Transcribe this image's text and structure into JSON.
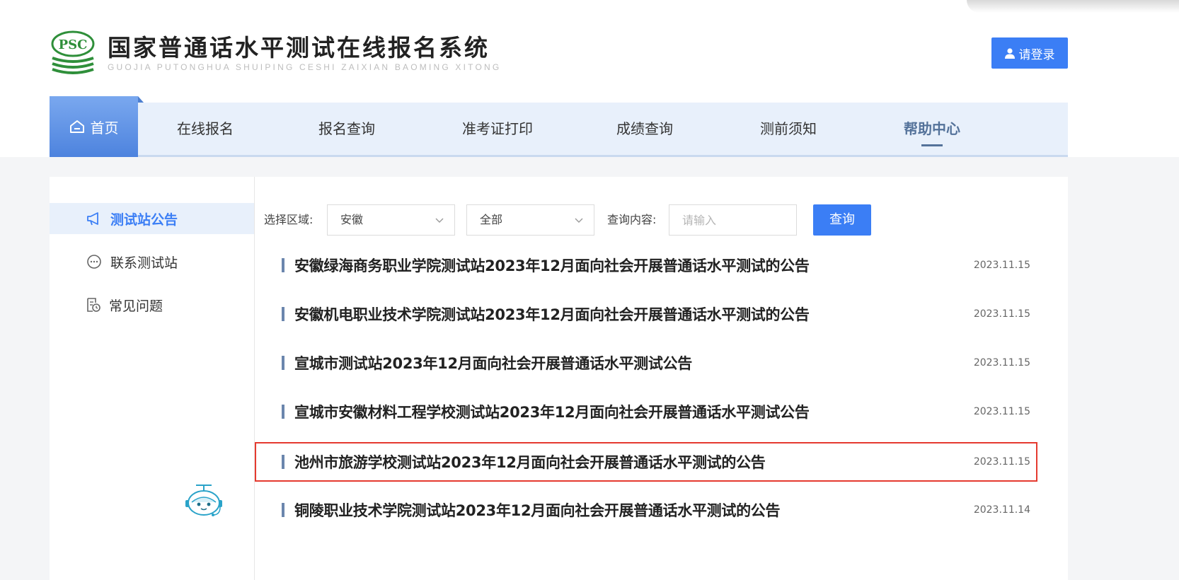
{
  "header": {
    "logo_badge": "PSC",
    "title": "国家普通话水平测试在线报名系统",
    "subtitle": "GUOJIA PUTONGHUA SHUIPING CESHI ZAIXIAN BAOMING XITONG",
    "login_label": "请登录"
  },
  "nav": {
    "home": "首页",
    "items": [
      "在线报名",
      "报名查询",
      "准考证打印",
      "成绩查询",
      "测前须知",
      "帮助中心"
    ],
    "active": "帮助中心"
  },
  "sidebar": {
    "items": [
      {
        "label": "测试站公告",
        "icon": "megaphone-icon",
        "active": true
      },
      {
        "label": "联系测试站",
        "icon": "chat-bubble-icon",
        "active": false
      },
      {
        "label": "常见问题",
        "icon": "document-clock-icon",
        "active": false
      }
    ]
  },
  "filters": {
    "region_label": "选择区域:",
    "region_value": "安徽",
    "category_value": "全部",
    "query_label": "查询内容:",
    "query_placeholder": "请输入",
    "query_button": "查询"
  },
  "announcements": [
    {
      "title": "安徽绿海商务职业学院测试站2023年12月面向社会开展普通话水平测试的公告",
      "date": "2023.11.15"
    },
    {
      "title": "安徽机电职业技术学院测试站2023年12月面向社会开展普通话水平测试的公告",
      "date": "2023.11.15"
    },
    {
      "title": "宣城市测试站2023年12月面向社会开展普通话水平测试公告",
      "date": "2023.11.15"
    },
    {
      "title": "宣城市安徽材料工程学校测试站2023年12月面向社会开展普通话水平测试公告",
      "date": "2023.11.15"
    },
    {
      "title": "池州市旅游学校测试站2023年12月面向社会开展普通话水平测试的公告",
      "date": "2023.11.15"
    },
    {
      "title": "铜陵职业技术学院测试站2023年12月面向社会开展普通话水平测试的公告",
      "date": "2023.11.14"
    }
  ],
  "colors": {
    "accent": "#3b7ef5",
    "nav_bg": "#e8f0fb",
    "highlight_border": "#e53a2f"
  }
}
